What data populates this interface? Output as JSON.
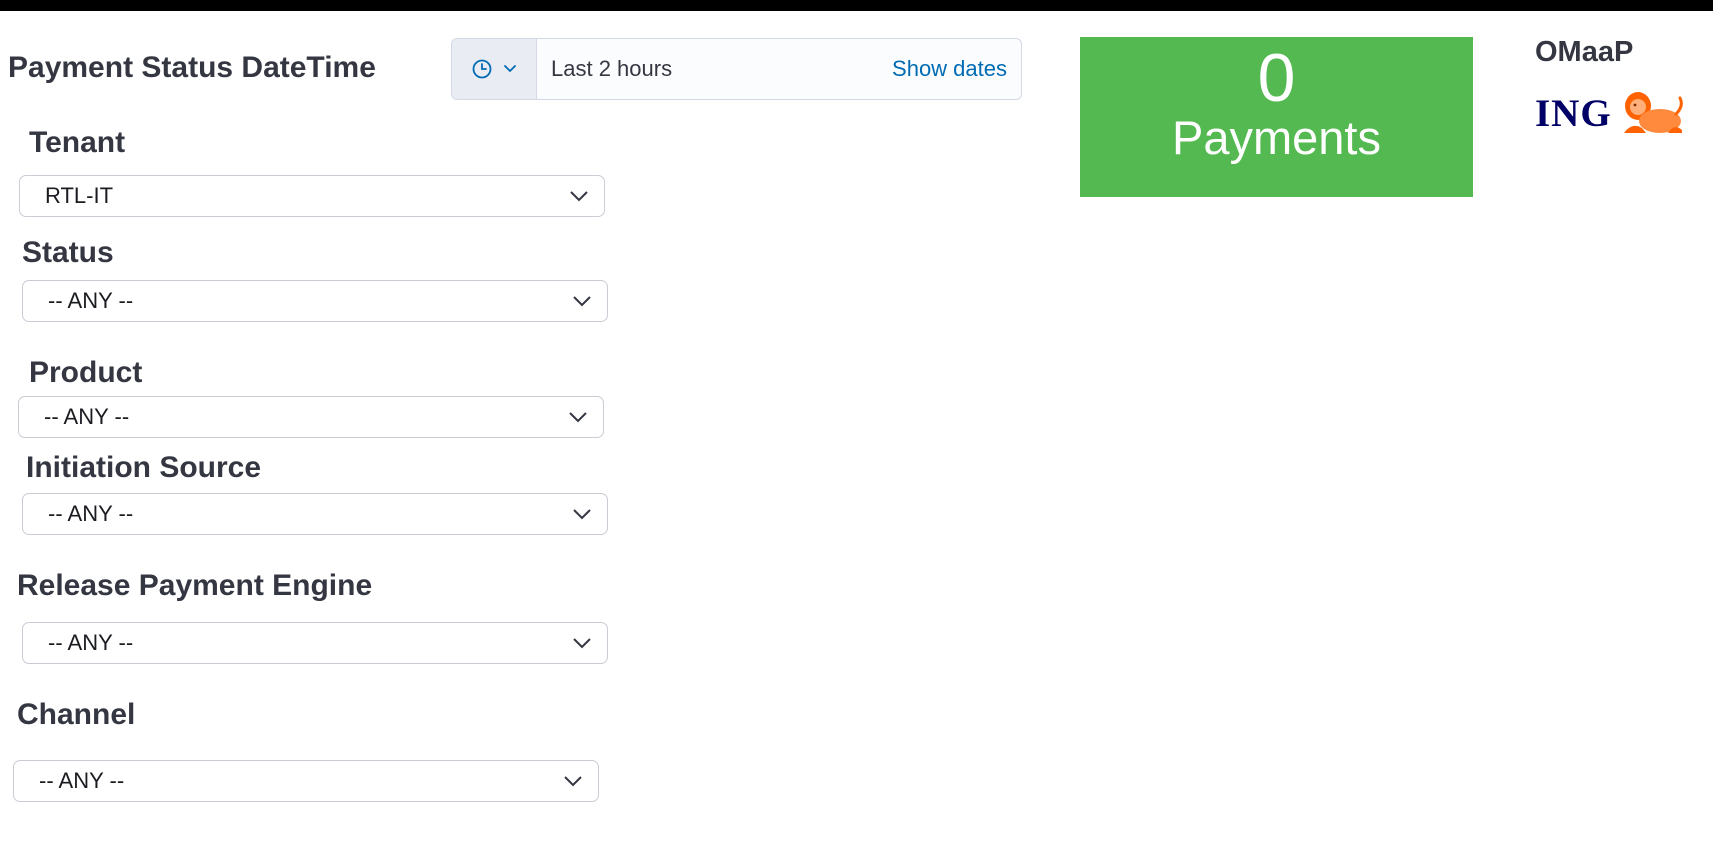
{
  "header": {
    "title": "Payment Status DateTime"
  },
  "date_picker": {
    "range": "Last 2 hours",
    "show_dates": "Show dates",
    "icons": [
      "clock-icon",
      "chevron-down-icon"
    ]
  },
  "metric": {
    "value": "0",
    "label": "Payments",
    "color": "#54b951"
  },
  "brand": {
    "title": "OMaaP",
    "logo_text": "ING",
    "logo_color": "#000066",
    "lion_color": "#ff6200"
  },
  "filters": [
    {
      "label": "Tenant",
      "value": "RTL-IT"
    },
    {
      "label": "Status",
      "value": "-- ANY --"
    },
    {
      "label": "Product",
      "value": "-- ANY --"
    },
    {
      "label": "Initiation Source",
      "value": "-- ANY --"
    },
    {
      "label": "Release Payment Engine",
      "value": "-- ANY --"
    },
    {
      "label": "Channel",
      "value": "-- ANY --"
    }
  ]
}
